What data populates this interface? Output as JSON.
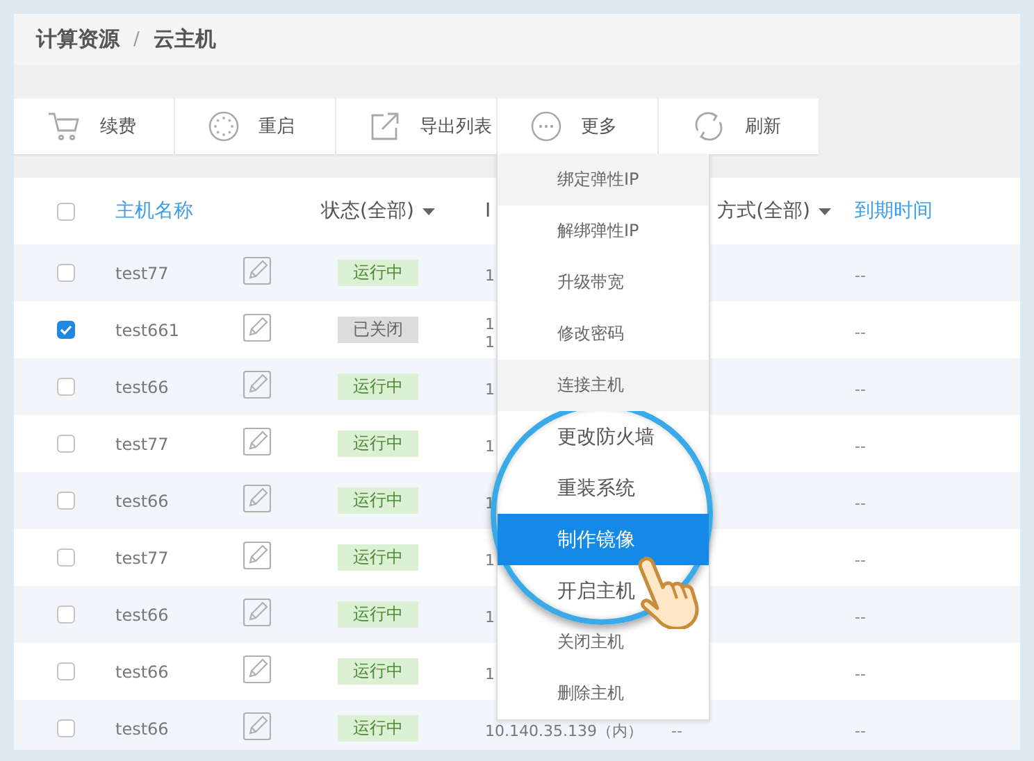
{
  "breadcrumb": {
    "items": [
      "计算资源",
      "云主机"
    ],
    "separator": "/"
  },
  "toolbar": [
    {
      "label": "续费",
      "kind": "cart"
    },
    {
      "label": "重启",
      "kind": "restart"
    },
    {
      "label": "导出列表",
      "kind": "export"
    },
    {
      "label": "更多",
      "kind": "more"
    },
    {
      "label": "刷新",
      "kind": "refresh"
    }
  ],
  "table": {
    "select_all": {
      "checked": false
    },
    "columns": [
      {
        "label": "主机名称",
        "kind": "link"
      },
      {
        "label": "状态(全部)",
        "kind": "filter"
      },
      {
        "label": "I",
        "kind": "plain"
      },
      {
        "label": "方式(全部)",
        "kind": "filter"
      },
      {
        "label": "到期时间",
        "kind": "link"
      }
    ],
    "rows": [
      {
        "checked": false,
        "name": "test77",
        "status": "运行中",
        "kind": "running",
        "ip": [
          "1"
        ],
        "expiry": "--"
      },
      {
        "checked": true,
        "name": "test661",
        "status": "已关闭",
        "kind": "stopped",
        "ip": [
          "1",
          "1"
        ],
        "expiry": "--"
      },
      {
        "checked": false,
        "name": "test66",
        "status": "运行中",
        "kind": "running",
        "ip": [
          "1"
        ],
        "expiry": "--"
      },
      {
        "checked": false,
        "name": "test77",
        "status": "运行中",
        "kind": "running",
        "ip": [
          "1"
        ],
        "expiry": "--"
      },
      {
        "checked": false,
        "name": "test66",
        "status": "运行中",
        "kind": "running",
        "ip": [
          "1"
        ],
        "expiry": "--"
      },
      {
        "checked": false,
        "name": "test77",
        "status": "运行中",
        "kind": "running",
        "ip": [
          "1"
        ],
        "expiry": "--"
      },
      {
        "checked": false,
        "name": "test66",
        "status": "运行中",
        "kind": "running",
        "ip": [
          "1"
        ],
        "expiry": "--"
      },
      {
        "checked": false,
        "name": "test66",
        "status": "运行中",
        "kind": "running",
        "ip": [
          "1"
        ],
        "expiry": "--"
      },
      {
        "checked": false,
        "name": "test66",
        "status": "运行中",
        "kind": "running",
        "ip": [
          "10.140.35.139（内）"
        ],
        "billing": "--",
        "expiry": "--"
      }
    ]
  },
  "more_menu": {
    "items": [
      {
        "label": "绑定弹性IP",
        "selected": false,
        "magnified": false
      },
      {
        "label": "解绑弹性IP",
        "selected": false,
        "magnified": false
      },
      {
        "label": "升级带宽",
        "selected": false,
        "magnified": false
      },
      {
        "label": "修改密码",
        "selected": false,
        "magnified": false
      },
      {
        "label": "连接主机",
        "selected": false,
        "magnified": false
      },
      {
        "label": "更改防火墙",
        "selected": false,
        "magnified": true
      },
      {
        "label": "重装系统",
        "selected": false,
        "magnified": true
      },
      {
        "label": "制作镜像",
        "selected": true,
        "magnified": true
      },
      {
        "label": "开启主机",
        "selected": false,
        "magnified": true
      },
      {
        "label": "关闭主机",
        "selected": false,
        "magnified": false
      },
      {
        "label": "删除主机",
        "selected": false,
        "magnified": false
      }
    ]
  }
}
